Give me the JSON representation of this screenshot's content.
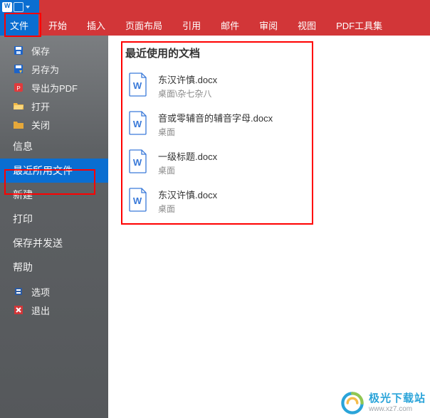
{
  "ribbon": {
    "file": "文件",
    "home": "开始",
    "insert": "插入",
    "layout": "页面布局",
    "references": "引用",
    "mail": "邮件",
    "review": "审阅",
    "view": "视图",
    "pdftools": "PDF工具集"
  },
  "sidebar": {
    "save": "保存",
    "saveas": "另存为",
    "exportpdf": "导出为PDF",
    "open": "打开",
    "close": "关闭",
    "info": "信息",
    "recent": "最近所用文件",
    "new_": "新建",
    "print": "打印",
    "saveandsend": "保存并发送",
    "help": "帮助",
    "options": "选项",
    "exit": "退出"
  },
  "content": {
    "recent_title": "最近使用的文档",
    "docs": [
      {
        "name": "东汉许慎.docx",
        "path": "桌面\\杂七杂八"
      },
      {
        "name": "音或零辅音的辅音字母.docx",
        "path": "桌面"
      },
      {
        "name": "一级标题.docx",
        "path": "桌面"
      },
      {
        "name": "东汉许慎.docx",
        "path": "桌面"
      }
    ]
  },
  "watermark": {
    "main": "极光下载站",
    "sub": "www.xz7.com"
  }
}
